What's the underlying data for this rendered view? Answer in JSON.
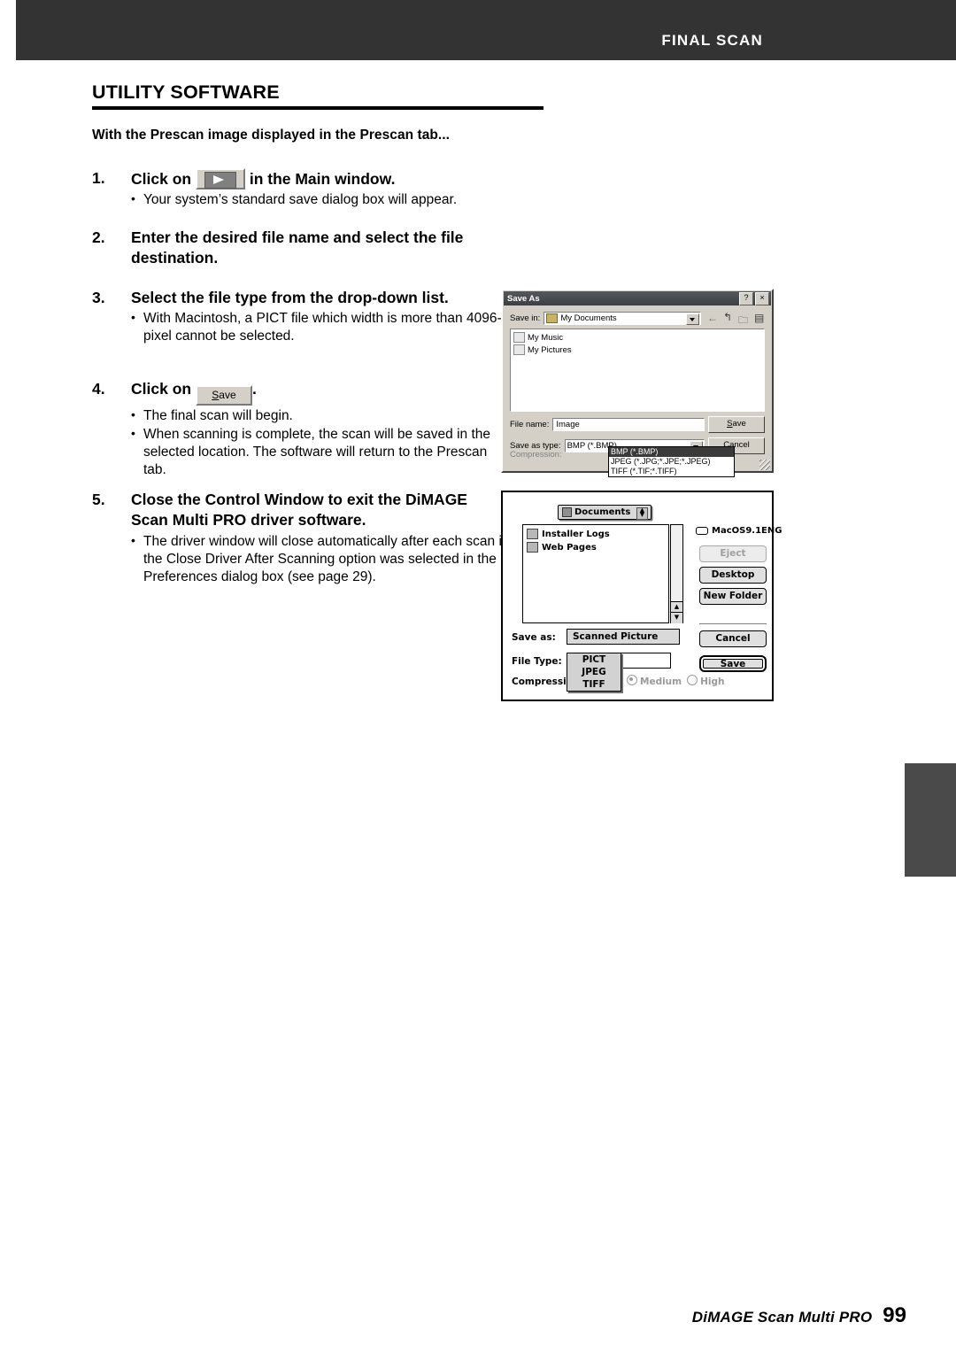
{
  "header": {
    "title": "FINAL SCAN"
  },
  "section": {
    "heading": "UTILITY SOFTWARE",
    "intro": "With the Prescan image displayed in the Prescan tab..."
  },
  "steps": [
    {
      "num": "1.",
      "title_before": "Click on",
      "icon": "scan-button-icon",
      "title_after": "in the Main window.",
      "bullets": [
        "Your system’s standard save dialog box will appear."
      ]
    },
    {
      "num": "2.",
      "title": "Enter the desired file name and select the file destination.",
      "bullets": []
    },
    {
      "num": "3.",
      "title": "Select the file type from the drop-down list.",
      "bullets": [
        "With Macintosh, a PICT file which width is more than 4096-pixel cannot be selected."
      ]
    },
    {
      "num": "4.",
      "title_before": "Click on",
      "button_label": "Save",
      "button_accel": "S",
      "title_after": ".",
      "bullets": [
        "The final scan will begin.",
        "When scanning is complete, the scan will be saved in the selected location. The software will return to the Prescan tab."
      ]
    },
    {
      "num": "5.",
      "title": "Close the Control Window to exit the DiMAGE Scan Multi PRO driver software.",
      "bullets": [
        "The driver window will close automatically after each scan if the Close Driver After Scanning option was selected in the Preferences dialog box (see page 29)."
      ]
    }
  ],
  "windows_dialog": {
    "title": "Save As",
    "help_button": "?",
    "close_button": "×",
    "save_in_label": "Save in:",
    "save_in_value": "My Documents",
    "toolbar_icons": [
      "back-arrow-icon",
      "up-folder-icon",
      "new-folder-icon",
      "views-icon"
    ],
    "files": [
      "My Music",
      "My Pictures"
    ],
    "file_name_label": "File name:",
    "file_name_value": "Image",
    "file_name_accel": "n",
    "save_as_type_label": "Save as type:",
    "save_as_type_accel": "t",
    "save_as_type_value": "BMP (*.BMP)",
    "dropdown_options": [
      "BMP (*.BMP)",
      "JPEG (*.JPG;*.JPE;*.JPEG)",
      "TIFF (*.TIF;*.TIFF)"
    ],
    "dropdown_selected_index": 0,
    "compression_label": "Compression:",
    "save_button": "Save",
    "save_accel": "S",
    "cancel_button": "Cancel"
  },
  "mac_dialog": {
    "location_popup": "Documents",
    "files": [
      "Installer Logs",
      "Web Pages"
    ],
    "volume_name": "MacOS9.1ENG",
    "buttons": {
      "eject": "Eject",
      "desktop": "Desktop",
      "new_folder": "New Folder",
      "cancel": "Cancel",
      "save": "Save"
    },
    "save_as_label": "Save as:",
    "save_as_value": "Scanned Picture",
    "file_type_label": "File Type:",
    "file_type_value": "PICT",
    "file_type_options": [
      "PICT",
      "JPEG",
      "TIFF"
    ],
    "compression_label": "Compression :",
    "compression_options": [
      "Medium",
      "High"
    ],
    "compression_selected": "Medium"
  },
  "footer": {
    "product": "DiMAGE Scan Multi PRO",
    "page_number": "99"
  }
}
